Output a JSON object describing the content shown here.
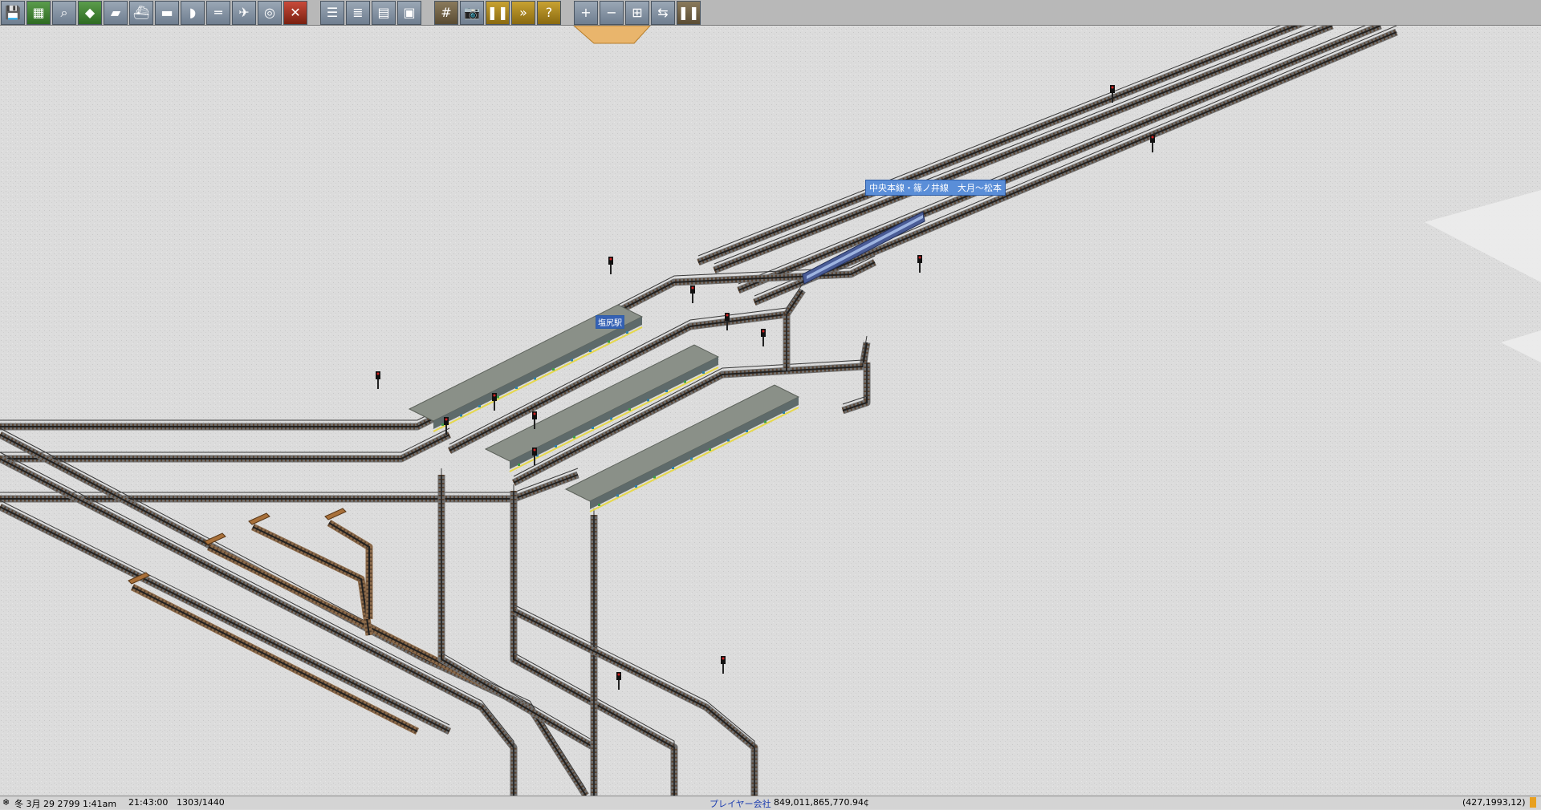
{
  "toolbar": {
    "buttons": [
      {
        "name": "save-icon",
        "glyph": "💾",
        "cls": ""
      },
      {
        "name": "map-icon",
        "glyph": "▦",
        "cls": "green"
      },
      {
        "name": "magnifier-icon",
        "glyph": "⌕",
        "cls": ""
      },
      {
        "name": "terrain-icon",
        "glyph": "◆",
        "cls": "green"
      },
      {
        "name": "train-icon",
        "glyph": "▰",
        "cls": ""
      },
      {
        "name": "ship-icon",
        "glyph": "⛴",
        "cls": ""
      },
      {
        "name": "road-vehicle-icon",
        "glyph": "▬",
        "cls": ""
      },
      {
        "name": "tram-icon",
        "glyph": "◗",
        "cls": ""
      },
      {
        "name": "monorail-icon",
        "glyph": "═",
        "cls": ""
      },
      {
        "name": "airplane-icon",
        "glyph": "✈",
        "cls": ""
      },
      {
        "name": "target-icon",
        "glyph": "◎",
        "cls": ""
      },
      {
        "name": "remove-icon",
        "glyph": "✕",
        "cls": "red"
      },
      {
        "gap": true
      },
      {
        "name": "schedule-icon",
        "glyph": "☰",
        "cls": ""
      },
      {
        "name": "list-icon",
        "glyph": "≣",
        "cls": ""
      },
      {
        "name": "finance-icon",
        "glyph": "▤",
        "cls": ""
      },
      {
        "name": "goods-icon",
        "glyph": "▣",
        "cls": ""
      },
      {
        "gap": true
      },
      {
        "name": "rail-tool-icon",
        "glyph": "#",
        "cls": "brown"
      },
      {
        "name": "camera-icon",
        "glyph": "📷",
        "cls": ""
      },
      {
        "name": "pause-icon",
        "glyph": "❚❚",
        "cls": "gold"
      },
      {
        "name": "fast-forward-icon",
        "glyph": "»",
        "cls": "gold"
      },
      {
        "name": "help-icon",
        "glyph": "?",
        "cls": "gold"
      },
      {
        "gap": true
      },
      {
        "name": "zoom-in-icon",
        "glyph": "+",
        "cls": ""
      },
      {
        "name": "zoom-out-icon",
        "glyph": "−",
        "cls": ""
      },
      {
        "name": "grid-icon",
        "glyph": "⊞",
        "cls": ""
      },
      {
        "name": "network-icon",
        "glyph": "⇆",
        "cls": ""
      },
      {
        "name": "pause2-icon",
        "glyph": "❚❚",
        "cls": "brown"
      }
    ]
  },
  "map": {
    "line_label": "中央本線・篠ノ井線　大月～松本",
    "station_label": "塩尻駅"
  },
  "status": {
    "date": "冬 3月 29 2799  1:41am",
    "clock": "21:43:00",
    "ratio": "1303/1440",
    "company": "プレイヤー会社",
    "money": "849,011,865,770.94¢",
    "coords": "(427,1993,12)"
  }
}
